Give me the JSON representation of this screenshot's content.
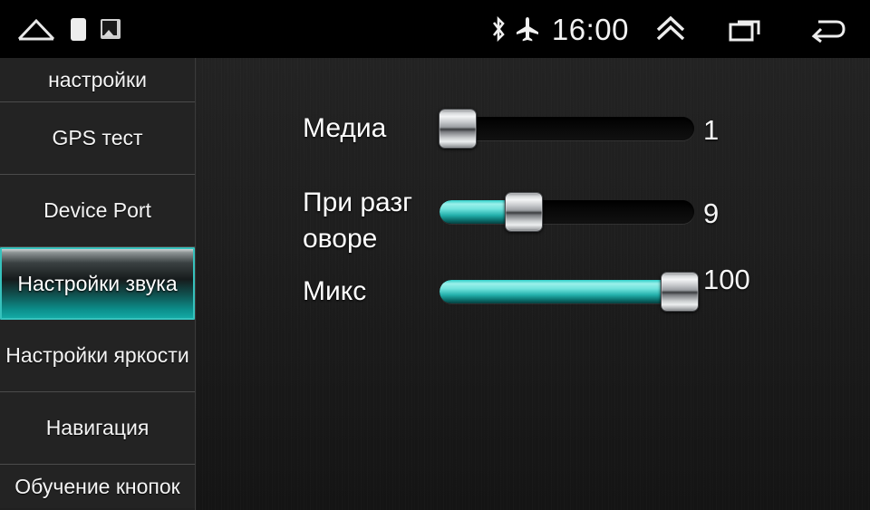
{
  "statusbar": {
    "time": "16:00",
    "icons": {
      "home": "home-icon",
      "tile": "app-tile-icon",
      "photo": "photo-icon",
      "bluetooth": "bluetooth-icon",
      "airplane": "airplane-mode-icon",
      "chevron_up": "double-chevron-up-icon",
      "recent_apps": "recent-apps-icon",
      "back": "back-arrow-icon"
    }
  },
  "sidebar": {
    "items": [
      {
        "label": "настройки",
        "selected": false
      },
      {
        "label": "GPS тест",
        "selected": false
      },
      {
        "label": "Device Port",
        "selected": false
      },
      {
        "label": "Настройки звука",
        "selected": true
      },
      {
        "label": "Настройки яркости",
        "selected": false
      },
      {
        "label": "Навигация",
        "selected": false
      },
      {
        "label": "Обучение кнопок",
        "selected": false
      }
    ]
  },
  "main": {
    "accent_color": "#36c2bd",
    "background_color": "#1e1e1e",
    "sliders": [
      {
        "label": "Медиа",
        "value": "1",
        "percent": 2,
        "min": 0,
        "max": 100
      },
      {
        "label": "При разг оворе",
        "label_line1": "При разг",
        "label_line2": "оворе",
        "value": "9",
        "percent": 26,
        "min": 0,
        "max": 100
      },
      {
        "label": "Микс",
        "value": "100",
        "percent": 100,
        "min": 0,
        "max": 100
      }
    ]
  }
}
